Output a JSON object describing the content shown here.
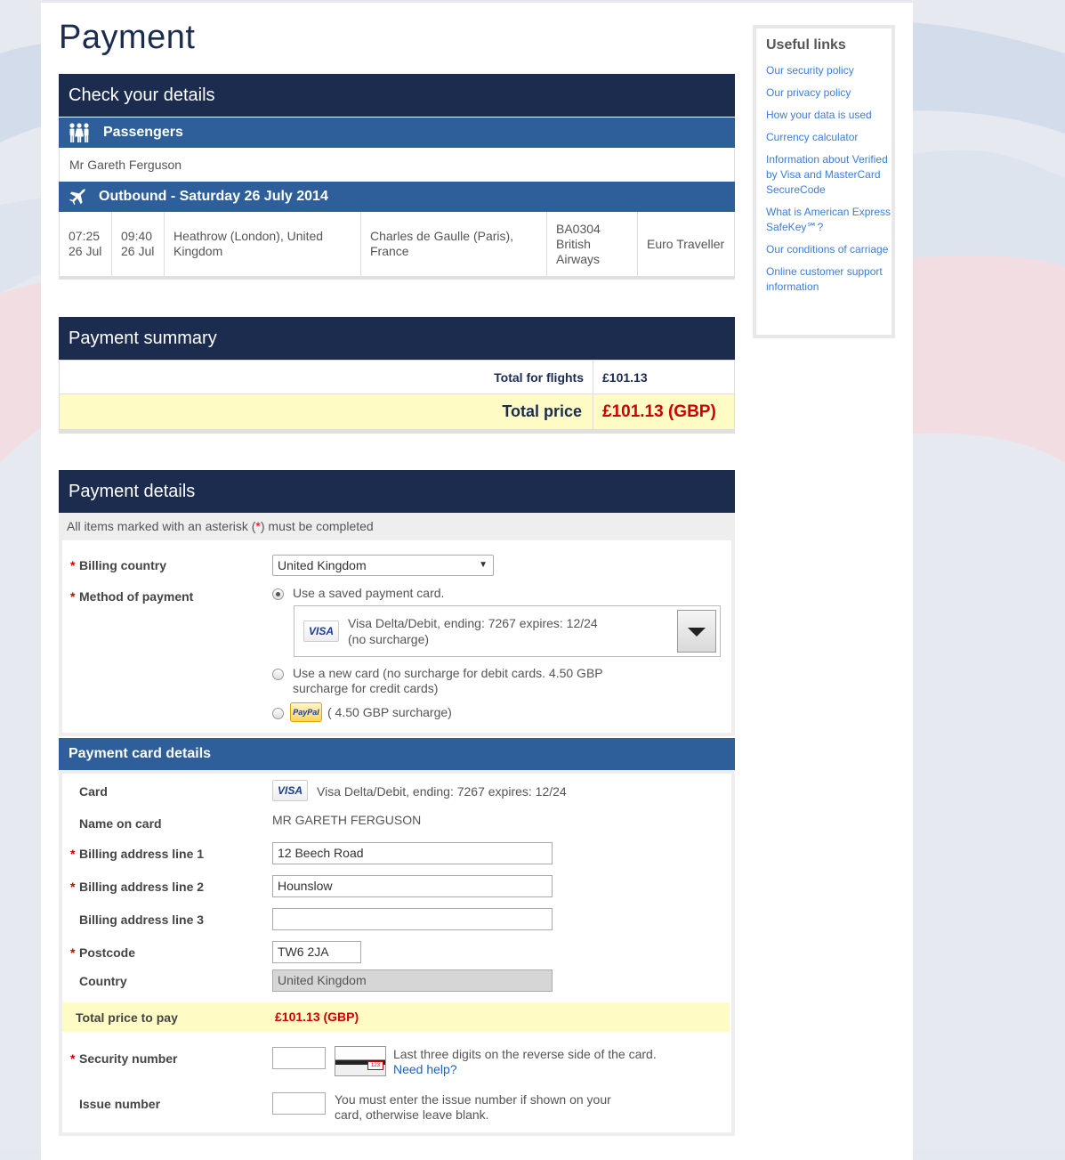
{
  "page": {
    "title": "Payment"
  },
  "check_details": {
    "heading": "Check your details",
    "passengers_heading": "Passengers",
    "passenger_name": "Mr Gareth Ferguson",
    "outbound_heading": "Outbound - Saturday 26 July 2014",
    "flight": {
      "depart_time": "07:25",
      "depart_date": "26 Jul",
      "arrive_time": "09:40",
      "arrive_date": "26 Jul",
      "origin": "Heathrow (London), United Kingdom",
      "destination": "Charles de Gaulle (Paris), France",
      "flight_number": "BA0304",
      "airline": "British Airways",
      "cabin": "Euro Traveller"
    }
  },
  "payment_summary": {
    "heading": "Payment summary",
    "flights_label": "Total for flights",
    "flights_value": "£101.13",
    "total_label": "Total price",
    "total_value": "£101.13 (GBP)"
  },
  "payment_details": {
    "heading": "Payment details",
    "notice_before": "All items marked with an asterisk (",
    "notice_asterisk": "*",
    "notice_after": ") must be completed",
    "billing_country_label": "Billing country",
    "billing_country_value": "United Kingdom",
    "method_label": "Method of payment",
    "option_saved": "Use a saved payment card.",
    "saved_card_line1": "Visa Delta/Debit, ending: 7267 expires: 12/24",
    "saved_card_line2": "(no surcharge)",
    "option_new_line1": "Use a new card (no surcharge for debit cards. 4.50 GBP",
    "option_new_line2": "surcharge for credit cards)",
    "option_paypal": "( 4.50 GBP surcharge)",
    "visa_text": "VISA",
    "paypal_text": "PayPal"
  },
  "card_details": {
    "heading": "Payment card details",
    "card_label": "Card",
    "card_value": "Visa Delta/Debit, ending: 7267 expires: 12/24",
    "name_label": "Name on card",
    "name_value": "MR GARETH FERGUSON",
    "addr1_label": "Billing address line 1",
    "addr1_value": "12 Beech Road",
    "addr2_label": "Billing address line 2",
    "addr2_value": "Hounslow",
    "addr3_label": "Billing address line 3",
    "addr3_value": "",
    "postcode_label": "Postcode",
    "postcode_value": "TW6 2JA",
    "country_label": "Country",
    "country_value": "United Kingdom",
    "total_label": "Total price to pay",
    "total_value": "£101.13 (GBP)",
    "security_label": "Security number",
    "security_help": "Last three digits on the reverse side of the card.",
    "security_link": "Need help?",
    "card_digits": "123",
    "issue_label": "Issue number",
    "issue_help_line1": "You must enter the issue number if shown on your",
    "issue_help_line2": "card, otherwise leave blank."
  },
  "sidebar": {
    "heading": "Useful links",
    "links": [
      "Our security policy",
      "Our privacy policy",
      "How your data is used",
      "Currency calculator",
      "Information about Verified by Visa and MasterCard SecureCode",
      "What is American Express SafeKey℠?",
      "Our conditions of carriage",
      "Online customer support information"
    ]
  },
  "colors": {
    "navy": "#1b2c4f",
    "blue": "#2e5f9a",
    "highlight": "#fefbc5",
    "price_red": "#cc0000",
    "link": "#3b7dd8"
  }
}
